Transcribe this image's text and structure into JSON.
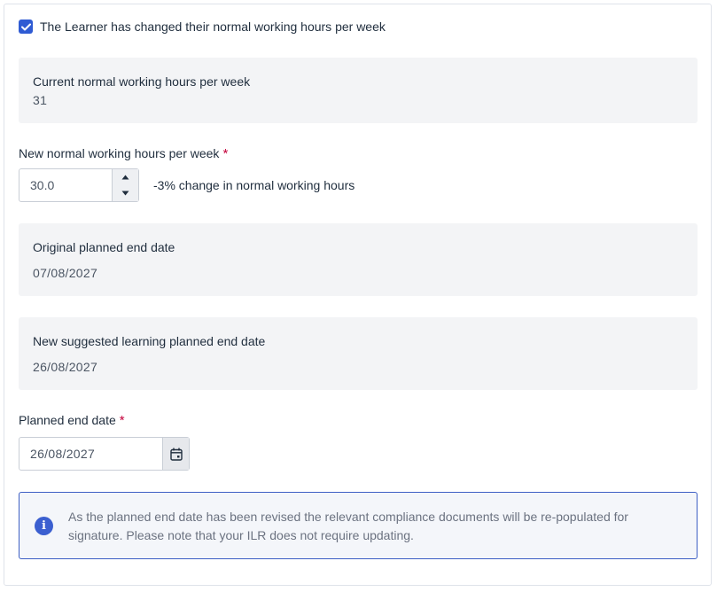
{
  "checkbox": {
    "checked": true,
    "label": "The Learner has changed their normal working hours per week"
  },
  "current_hours": {
    "label": "Current normal working hours per week",
    "value": "31"
  },
  "new_hours": {
    "label": "New normal working hours per week",
    "required_marker": "*",
    "value": "30.0",
    "change_text": "-3% change in normal working hours"
  },
  "original_end_date": {
    "label": "Original planned end date",
    "value": "07/08/2027"
  },
  "suggested_end_date": {
    "label": "New suggested learning planned end date",
    "value": "26/08/2027"
  },
  "planned_end_date": {
    "label": "Planned end date",
    "required_marker": "*",
    "value": "26/08/2027"
  },
  "info": {
    "icon": "info-icon",
    "text": "As the planned end date has been revised the relevant compliance documents will be re-populated for signature. Please note that your ILR does not require updating."
  },
  "colors": {
    "accent": "#2f5bd3",
    "required": "#c4003a",
    "panel_bg": "#f3f4f6",
    "info_border": "#3d5fc4"
  }
}
